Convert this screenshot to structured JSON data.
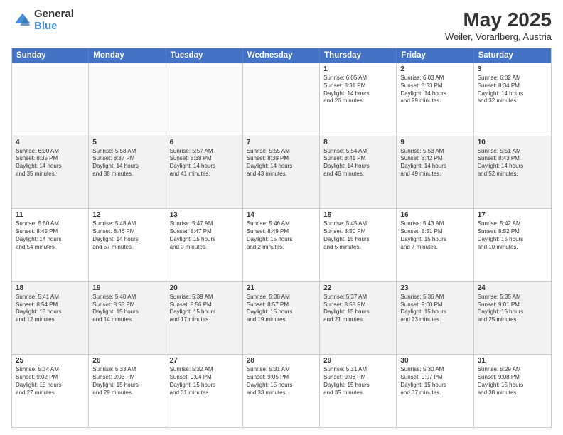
{
  "logo": {
    "line1": "General",
    "line2": "Blue"
  },
  "title": "May 2025",
  "location": "Weiler, Vorarlberg, Austria",
  "days": [
    "Sunday",
    "Monday",
    "Tuesday",
    "Wednesday",
    "Thursday",
    "Friday",
    "Saturday"
  ],
  "weeks": [
    [
      {
        "day": "",
        "info": ""
      },
      {
        "day": "",
        "info": ""
      },
      {
        "day": "",
        "info": ""
      },
      {
        "day": "",
        "info": ""
      },
      {
        "day": "1",
        "info": "Sunrise: 6:05 AM\nSunset: 8:31 PM\nDaylight: 14 hours\nand 26 minutes."
      },
      {
        "day": "2",
        "info": "Sunrise: 6:03 AM\nSunset: 8:33 PM\nDaylight: 14 hours\nand 29 minutes."
      },
      {
        "day": "3",
        "info": "Sunrise: 6:02 AM\nSunset: 8:34 PM\nDaylight: 14 hours\nand 32 minutes."
      }
    ],
    [
      {
        "day": "4",
        "info": "Sunrise: 6:00 AM\nSunset: 8:35 PM\nDaylight: 14 hours\nand 35 minutes."
      },
      {
        "day": "5",
        "info": "Sunrise: 5:58 AM\nSunset: 8:37 PM\nDaylight: 14 hours\nand 38 minutes."
      },
      {
        "day": "6",
        "info": "Sunrise: 5:57 AM\nSunset: 8:38 PM\nDaylight: 14 hours\nand 41 minutes."
      },
      {
        "day": "7",
        "info": "Sunrise: 5:55 AM\nSunset: 8:39 PM\nDaylight: 14 hours\nand 43 minutes."
      },
      {
        "day": "8",
        "info": "Sunrise: 5:54 AM\nSunset: 8:41 PM\nDaylight: 14 hours\nand 46 minutes."
      },
      {
        "day": "9",
        "info": "Sunrise: 5:53 AM\nSunset: 8:42 PM\nDaylight: 14 hours\nand 49 minutes."
      },
      {
        "day": "10",
        "info": "Sunrise: 5:51 AM\nSunset: 8:43 PM\nDaylight: 14 hours\nand 52 minutes."
      }
    ],
    [
      {
        "day": "11",
        "info": "Sunrise: 5:50 AM\nSunset: 8:45 PM\nDaylight: 14 hours\nand 54 minutes."
      },
      {
        "day": "12",
        "info": "Sunrise: 5:48 AM\nSunset: 8:46 PM\nDaylight: 14 hours\nand 57 minutes."
      },
      {
        "day": "13",
        "info": "Sunrise: 5:47 AM\nSunset: 8:47 PM\nDaylight: 15 hours\nand 0 minutes."
      },
      {
        "day": "14",
        "info": "Sunrise: 5:46 AM\nSunset: 8:49 PM\nDaylight: 15 hours\nand 2 minutes."
      },
      {
        "day": "15",
        "info": "Sunrise: 5:45 AM\nSunset: 8:50 PM\nDaylight: 15 hours\nand 5 minutes."
      },
      {
        "day": "16",
        "info": "Sunrise: 5:43 AM\nSunset: 8:51 PM\nDaylight: 15 hours\nand 7 minutes."
      },
      {
        "day": "17",
        "info": "Sunrise: 5:42 AM\nSunset: 8:52 PM\nDaylight: 15 hours\nand 10 minutes."
      }
    ],
    [
      {
        "day": "18",
        "info": "Sunrise: 5:41 AM\nSunset: 8:54 PM\nDaylight: 15 hours\nand 12 minutes."
      },
      {
        "day": "19",
        "info": "Sunrise: 5:40 AM\nSunset: 8:55 PM\nDaylight: 15 hours\nand 14 minutes."
      },
      {
        "day": "20",
        "info": "Sunrise: 5:39 AM\nSunset: 8:56 PM\nDaylight: 15 hours\nand 17 minutes."
      },
      {
        "day": "21",
        "info": "Sunrise: 5:38 AM\nSunset: 8:57 PM\nDaylight: 15 hours\nand 19 minutes."
      },
      {
        "day": "22",
        "info": "Sunrise: 5:37 AM\nSunset: 8:58 PM\nDaylight: 15 hours\nand 21 minutes."
      },
      {
        "day": "23",
        "info": "Sunrise: 5:36 AM\nSunset: 9:00 PM\nDaylight: 15 hours\nand 23 minutes."
      },
      {
        "day": "24",
        "info": "Sunrise: 5:35 AM\nSunset: 9:01 PM\nDaylight: 15 hours\nand 25 minutes."
      }
    ],
    [
      {
        "day": "25",
        "info": "Sunrise: 5:34 AM\nSunset: 9:02 PM\nDaylight: 15 hours\nand 27 minutes."
      },
      {
        "day": "26",
        "info": "Sunrise: 5:33 AM\nSunset: 9:03 PM\nDaylight: 15 hours\nand 29 minutes."
      },
      {
        "day": "27",
        "info": "Sunrise: 5:32 AM\nSunset: 9:04 PM\nDaylight: 15 hours\nand 31 minutes."
      },
      {
        "day": "28",
        "info": "Sunrise: 5:31 AM\nSunset: 9:05 PM\nDaylight: 15 hours\nand 33 minutes."
      },
      {
        "day": "29",
        "info": "Sunrise: 5:31 AM\nSunset: 9:06 PM\nDaylight: 15 hours\nand 35 minutes."
      },
      {
        "day": "30",
        "info": "Sunrise: 5:30 AM\nSunset: 9:07 PM\nDaylight: 15 hours\nand 37 minutes."
      },
      {
        "day": "31",
        "info": "Sunrise: 5:29 AM\nSunset: 9:08 PM\nDaylight: 15 hours\nand 38 minutes."
      }
    ]
  ]
}
